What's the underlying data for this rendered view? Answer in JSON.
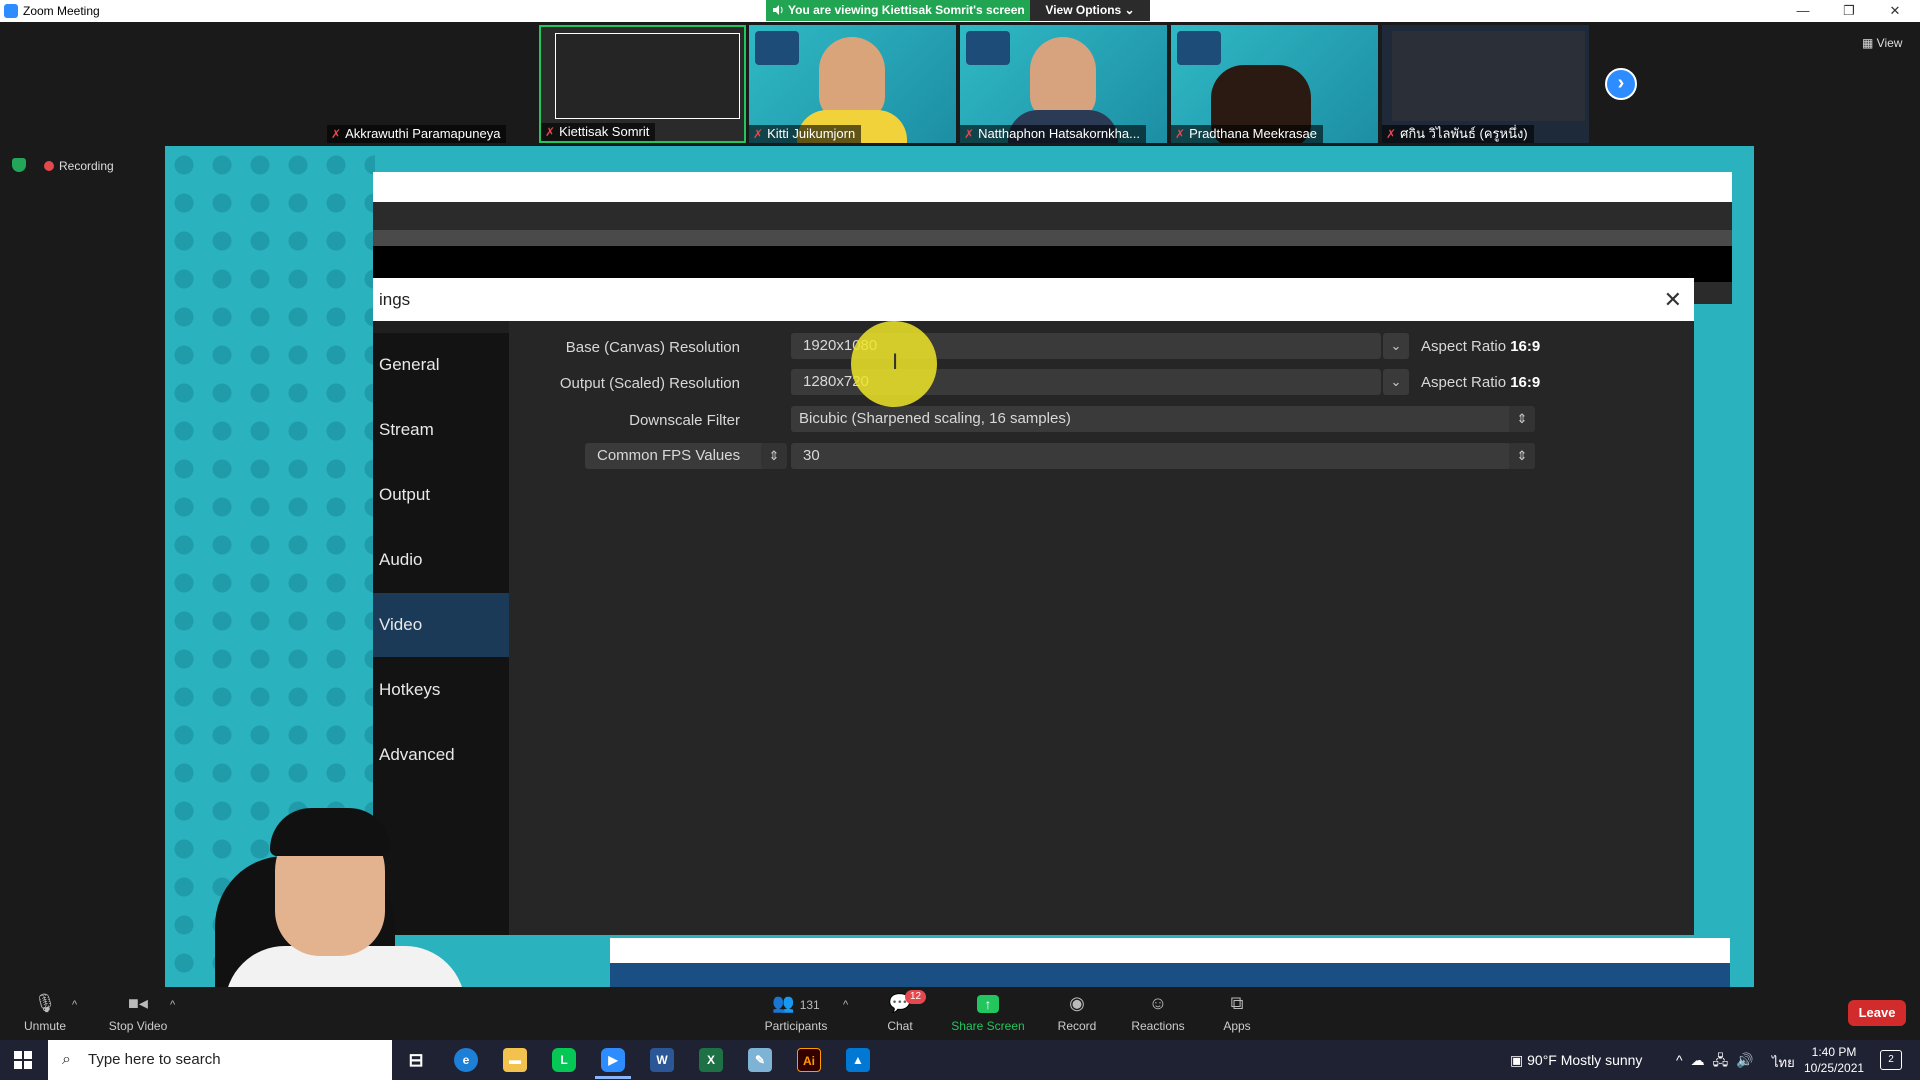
{
  "window": {
    "title": "Zoom Meeting",
    "minimize": "—",
    "restore": "❐",
    "close": "✕"
  },
  "banner": {
    "viewing": "You are viewing Kiettisak Somrit's screen",
    "view_options": "View Options ⌄"
  },
  "thumbnails": [
    {
      "name": "Akkrawuthi Paramapuneya"
    },
    {
      "name": "Kiettisak Somrit"
    },
    {
      "name": "Kitti Juikumjorn"
    },
    {
      "name": "Natthaphon Hatsakornkha..."
    },
    {
      "name": "Pradthana Meekrasae"
    },
    {
      "name": "ศกิน วิไลพันธ์ (ครูหนึ่ง)"
    }
  ],
  "view_label": "View",
  "recording_label": "Recording",
  "obs": {
    "dialog_title": "ings",
    "nav": [
      "General",
      "Stream",
      "Output",
      "Audio",
      "Video",
      "Hotkeys",
      "Advanced"
    ],
    "active_nav": "Video",
    "base_label": "Base (Canvas) Resolution",
    "base_value": "1920x1080",
    "output_label": "Output (Scaled) Resolution",
    "output_value": "1280x720",
    "aspect_label": "Aspect Ratio",
    "aspect_value": "16:9",
    "downscale_label": "Downscale Filter",
    "downscale_value": "Bicubic (Sharpened scaling, 16 samples)",
    "fps_type": "Common FPS Values",
    "fps_value": "30"
  },
  "toolbar": {
    "unmute": "Unmute",
    "stop_video": "Stop Video",
    "participants": "Participants",
    "participants_count": "131",
    "chat": "Chat",
    "chat_badge": "12",
    "share_screen": "Share Screen",
    "record": "Record",
    "reactions": "Reactions",
    "apps": "Apps",
    "leave": "Leave"
  },
  "taskbar": {
    "search_placeholder": "Type here to search",
    "weather": "90°F  Mostly sunny",
    "lang": "ไทย",
    "time": "1:40 PM",
    "date": "10/25/2021",
    "notif_count": "2"
  }
}
